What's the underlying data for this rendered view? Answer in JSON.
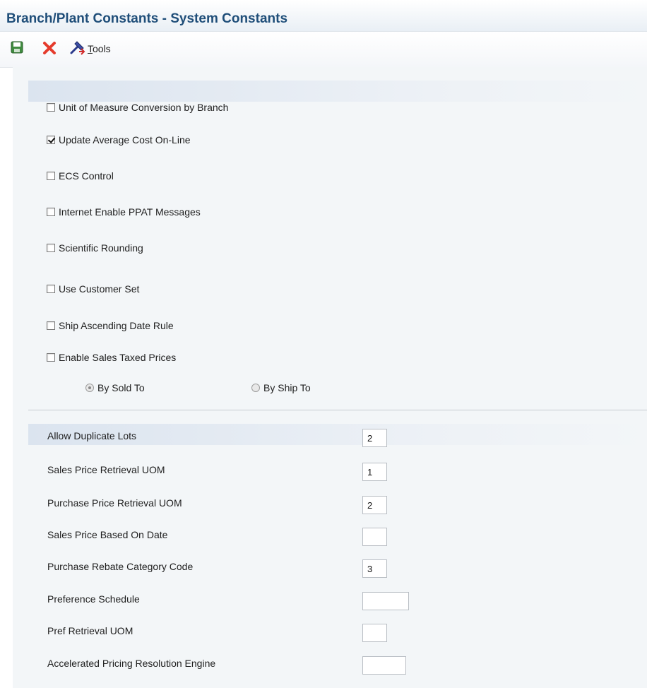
{
  "window": {
    "title": "Branch/Plant Constants - System Constants"
  },
  "toolbar": {
    "save_icon": "save-icon",
    "close_icon": "close-icon",
    "tools_icon": "tools-icon",
    "tools_label": "Tools"
  },
  "checkboxes": [
    {
      "label": "Unit of Measure Conversion by Branch",
      "checked": false
    },
    {
      "label": "Update Average Cost On-Line",
      "checked": true
    },
    {
      "label": "ECS Control",
      "checked": false
    },
    {
      "label": "Internet Enable PPAT Messages",
      "checked": false
    },
    {
      "label": "Scientific Rounding",
      "checked": false
    },
    {
      "label": "Use Customer Set",
      "checked": false
    },
    {
      "label": "Ship Ascending Date Rule",
      "checked": false
    },
    {
      "label": "Enable Sales Taxed Prices",
      "checked": false
    }
  ],
  "radios": [
    {
      "label": "By Sold To",
      "selected": true
    },
    {
      "label": "By Ship To",
      "selected": false
    }
  ],
  "fields": [
    {
      "label": "Allow Duplicate Lots",
      "value": "2"
    },
    {
      "label": "Sales Price Retrieval UOM",
      "value": "1"
    },
    {
      "label": "Purchase Price Retrieval UOM",
      "value": "2"
    },
    {
      "label": "Sales Price Based On Date",
      "value": ""
    },
    {
      "label": "Purchase Rebate Category Code",
      "value": "3"
    },
    {
      "label": "Preference Schedule",
      "value": ""
    },
    {
      "label": "Pref Retrieval UOM",
      "value": ""
    },
    {
      "label": "Accelerated Pricing Resolution Engine",
      "value": ""
    }
  ],
  "colors": {
    "title_text": "#1f4e79",
    "form_background": "#f3f6f8",
    "band": "#dbe4ef",
    "close_red": "#e53b2c",
    "save_green": "#3f8b3f"
  }
}
